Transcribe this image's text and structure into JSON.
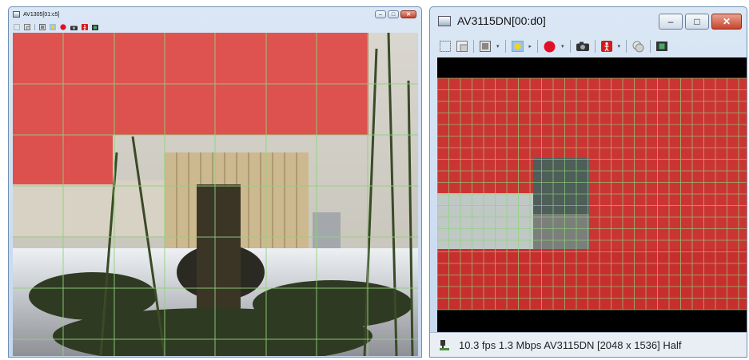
{
  "left_window": {
    "title": "AV1305[01:c5]",
    "caption_buttons": {
      "minimize": "–",
      "maximize": "□",
      "close": "✕"
    }
  },
  "right_window": {
    "title": "AV3115DN[00:d0]",
    "caption_buttons": {
      "minimize": "–",
      "maximize": "□",
      "close": "✕"
    },
    "status": "10.3 fps 1.3 Mbps AV3115DN [2048 x 1536] Half"
  },
  "toolbar_icons": [
    "select-region-icon",
    "window-layout-icon",
    "display-mode-icon",
    "image-adjust-icon",
    "record-icon",
    "snapshot-icon",
    "motion-detect-icon",
    "privacy-mask-icon",
    "film-icon"
  ],
  "colors": {
    "motion_mask": "#e02020",
    "grid_line": "#8fd27a",
    "title_bar": "#c6d8ee",
    "close_button": "#c6452c",
    "status_bar": "#e9eef5"
  }
}
